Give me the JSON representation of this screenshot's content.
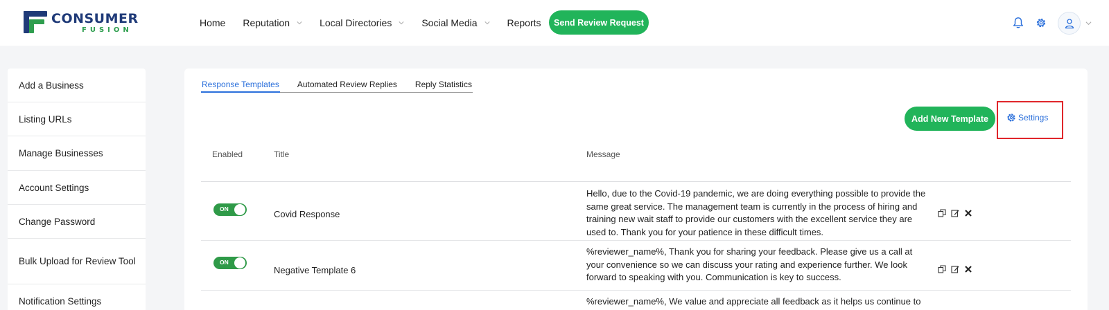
{
  "logo": {
    "word1": "CONSUMER",
    "word2": "FUSION"
  },
  "nav": {
    "items": [
      {
        "label": "Home",
        "dropdown": false
      },
      {
        "label": "Reputation",
        "dropdown": true
      },
      {
        "label": "Local Directories",
        "dropdown": true
      },
      {
        "label": "Social Media",
        "dropdown": true
      },
      {
        "label": "Reports",
        "dropdown": false
      }
    ],
    "cta": "Send Review Request"
  },
  "sidebar": {
    "items": [
      {
        "label": "Add a Business"
      },
      {
        "label": "Listing URLs"
      },
      {
        "label": "Manage Businesses"
      },
      {
        "label": "Account Settings"
      },
      {
        "label": "Change Password"
      },
      {
        "label": "Bulk Upload for Review Tool"
      },
      {
        "label": "Notification Settings"
      }
    ]
  },
  "tabs": [
    {
      "label": "Response Templates",
      "active": true
    },
    {
      "label": "Automated Review Replies",
      "active": false
    },
    {
      "label": "Reply Statistics",
      "active": false
    }
  ],
  "actions": {
    "add_template": "Add New Template",
    "settings": "Settings"
  },
  "table": {
    "headers": {
      "enabled": "Enabled",
      "title": "Title",
      "message": "Message"
    },
    "rows": [
      {
        "enabled": "ON",
        "title": "Covid Response",
        "message": "Hello, due to the Covid-19 pandemic, we are doing everything possible to provide the same great service. The management team is currently in the process of hiring and training new wait staff to provide our customers with the excellent service they are used to. Thank you for your patience in these difficult times."
      },
      {
        "enabled": "ON",
        "title": "Negative Template 6",
        "message": "%reviewer_name%, Thank you for sharing your feedback. Please give us a call at your convenience so we can discuss your rating and experience further. We look forward to speaking with you. Communication is key to success."
      },
      {
        "title": "",
        "message": "%reviewer_name%, We value and appreciate all feedback as it helps us continue to"
      }
    ]
  },
  "colors": {
    "accent_green": "#21b45a",
    "link_blue": "#2a6fdb",
    "highlight_red": "#e0262b",
    "brand_navy": "#1f3a78"
  }
}
